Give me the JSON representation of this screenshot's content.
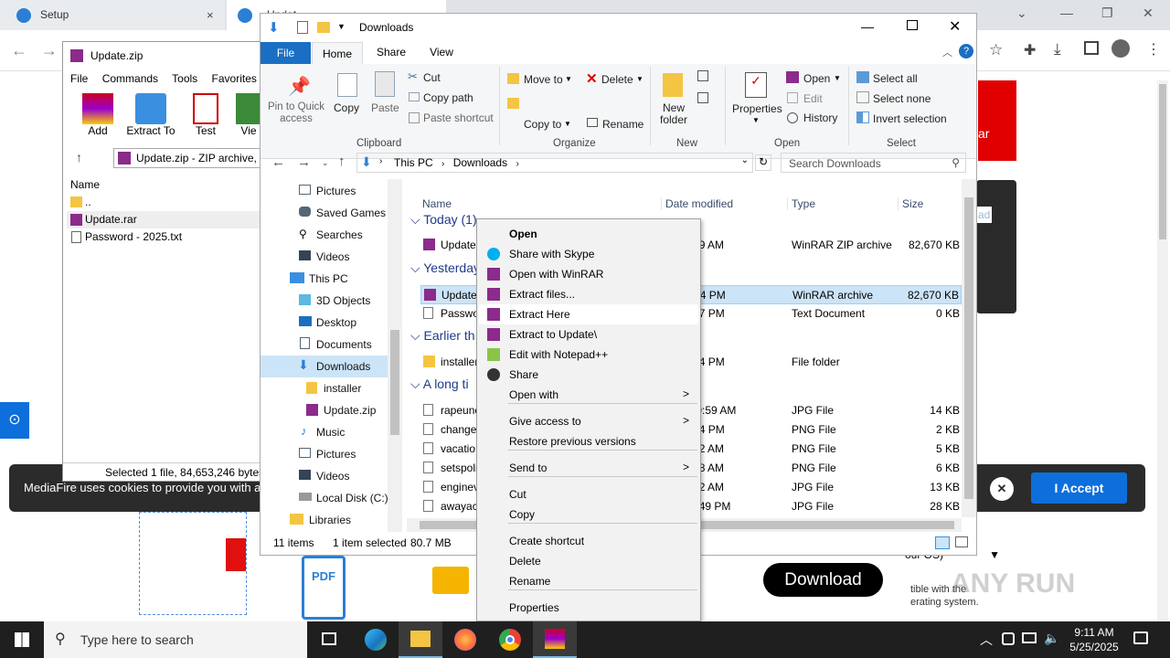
{
  "browser": {
    "tabs": [
      {
        "label": "Setup"
      },
      {
        "label": "Updat"
      }
    ],
    "tab_close": "×"
  },
  "page": {
    "cookie_text": "MediaFire uses cookies to provide you with a",
    "accept": "I Accept",
    "close": "✕",
    "download": "Download",
    "side_partial_text": "our OS)",
    "compat_text_1": "tible with the",
    "compat_text_2": "erating system.",
    "ad_text_1": "ar",
    "ad_text_2": "ad",
    "watermark": "ANY RUN"
  },
  "winrar": {
    "title": "Update.zip",
    "menu": [
      "File",
      "Commands",
      "Tools",
      "Favorites"
    ],
    "tools": [
      {
        "label": "Add"
      },
      {
        "label": "Extract To"
      },
      {
        "label": "Test"
      },
      {
        "label": "Vie"
      }
    ],
    "path": "Update.zip - ZIP archive, u",
    "col_name": "Name",
    "files": [
      ".. ",
      "Update.rar",
      "Password - 2025.txt"
    ],
    "status": "Selected 1 file, 84,653,246 bytes"
  },
  "explorer": {
    "title": "Downloads",
    "tabs": [
      "File",
      "Home",
      "Share",
      "View"
    ],
    "ribbon": {
      "pin": "Pin to Quick access",
      "copy": "Copy",
      "paste": "Paste",
      "cut": "Cut",
      "copy_path": "Copy path",
      "paste_shortcut": "Paste shortcut",
      "move_to": "Move to",
      "copy_to": "Copy to",
      "delete": "Delete",
      "rename": "Rename",
      "new_folder": "New folder",
      "properties": "Properties",
      "open": "Open",
      "edit": "Edit",
      "history": "History",
      "select_all": "Select all",
      "select_none": "Select none",
      "invert_selection": "Invert selection",
      "groups": [
        "Clipboard",
        "Organize",
        "New",
        "Open",
        "Select"
      ]
    },
    "address": [
      "This PC",
      "Downloads"
    ],
    "search_placeholder": "Search Downloads",
    "nav": [
      "Pictures",
      "Saved Games",
      "Searches",
      "Videos",
      "This PC",
      "3D Objects",
      "Desktop",
      "Documents",
      "Downloads",
      "installer",
      "Update.zip",
      "Music",
      "Pictures",
      "Videos",
      "Local Disk (C:)",
      "Libraries"
    ],
    "columns": {
      "name": "Name",
      "date": "Date modified",
      "type": "Type",
      "size": "Size"
    },
    "groups": [
      "Today (1)",
      "Yesterday",
      "Earlier th",
      "A long ti"
    ],
    "rows": [
      {
        "name": "Update",
        "date": "5 9:09 AM",
        "type": "WinRAR ZIP archive",
        "size": "82,670 KB"
      },
      {
        "name": "Update",
        "date": "5 9:24 PM",
        "type": "WinRAR archive",
        "size": "82,670 KB"
      },
      {
        "name": "Passwo",
        "date": "5 7:37 PM",
        "type": "Text Document",
        "size": "0 KB"
      },
      {
        "name": "installer",
        "date": "5 3:04 PM",
        "type": "File folder",
        "size": ""
      },
      {
        "name": "rapeunc",
        "date": "024 9:59 AM",
        "type": "JPG File",
        "size": "14 KB"
      },
      {
        "name": "change",
        "date": "2 2:44 PM",
        "type": "PNG File",
        "size": "2 KB"
      },
      {
        "name": "vacatio",
        "date": "3 3:32 AM",
        "type": "PNG File",
        "size": "5 KB"
      },
      {
        "name": "setspoli",
        "date": "2 8:18 AM",
        "type": "PNG File",
        "size": "6 KB"
      },
      {
        "name": "enginev",
        "date": "2 1:42 AM",
        "type": "JPG File",
        "size": "13 KB"
      },
      {
        "name": "awayac",
        "date": "8 12:49 PM",
        "type": "JPG File",
        "size": "28 KB"
      }
    ],
    "status": {
      "count": "11 items",
      "selected": "1 item selected",
      "size": "80.7 MB"
    }
  },
  "context_menu": {
    "items": [
      {
        "label": "Open",
        "icon": "",
        "arrow": ""
      },
      {
        "label": "Share with Skype",
        "icon": "skype",
        "arrow": ""
      },
      {
        "label": "Open with WinRAR",
        "icon": "winrar",
        "arrow": ""
      },
      {
        "label": "Extract files...",
        "icon": "winrar",
        "arrow": ""
      },
      {
        "label": "Extract Here",
        "icon": "winrar",
        "arrow": ""
      },
      {
        "label": "Extract to Update\\",
        "icon": "winrar",
        "arrow": ""
      },
      {
        "label": "Edit with Notepad++",
        "icon": "notepad",
        "arrow": ""
      },
      {
        "label": "Share",
        "icon": "share",
        "arrow": ""
      },
      {
        "label": "Open with",
        "icon": "",
        "arrow": ">"
      },
      {
        "label": "Give access to",
        "icon": "",
        "arrow": ">"
      },
      {
        "label": "Restore previous versions",
        "icon": "",
        "arrow": ""
      },
      {
        "label": "Send to",
        "icon": "",
        "arrow": ">"
      },
      {
        "label": "Cut",
        "icon": "",
        "arrow": ""
      },
      {
        "label": "Copy",
        "icon": "",
        "arrow": ""
      },
      {
        "label": "Create shortcut",
        "icon": "",
        "arrow": ""
      },
      {
        "label": "Delete",
        "icon": "",
        "arrow": ""
      },
      {
        "label": "Rename",
        "icon": "",
        "arrow": ""
      },
      {
        "label": "Properties",
        "icon": "",
        "arrow": ""
      }
    ]
  },
  "taskbar": {
    "search_placeholder": "Type here to search",
    "time": "9:11 AM",
    "date": "5/25/2025"
  }
}
